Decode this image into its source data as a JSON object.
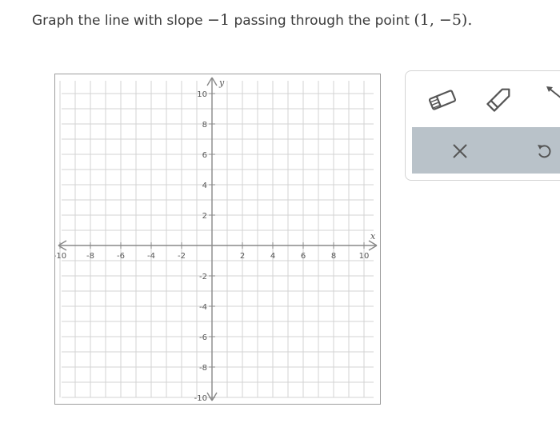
{
  "question": {
    "text": "Graph the line with slope ",
    "slope": "−1",
    "middle": " passing through the point ",
    "point": "(1, −5)."
  },
  "graph": {
    "x_range": [
      -10,
      10
    ],
    "y_range": [
      -10,
      10
    ],
    "grid_step": 1,
    "x_tick_labels": [
      "-10",
      "-8",
      "-6",
      "-4",
      "-2",
      "2",
      "4",
      "6",
      "8",
      "10"
    ],
    "y_tick_labels": [
      "10",
      "8",
      "6",
      "4",
      "2",
      "-2",
      "-4",
      "-6",
      "-8",
      "-10"
    ],
    "x_axis_label": "x",
    "y_axis_label": "y"
  },
  "tools": {
    "eraser_icon": "eraser-icon",
    "pencil_icon": "pencil-icon",
    "arrow_icon": "arrow-icon",
    "clear_icon": "close-icon",
    "undo_icon": "undo-icon"
  },
  "colors": {
    "grid": "#d3d3d3",
    "axis": "#888888",
    "action_bar": "#b9c2c9",
    "icon": "#555555"
  }
}
